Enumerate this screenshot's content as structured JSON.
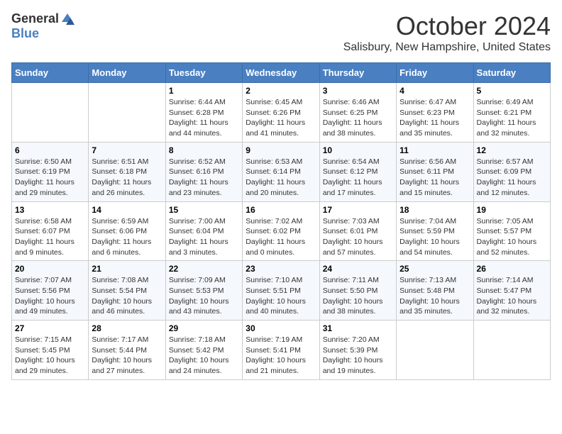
{
  "header": {
    "logo_general": "General",
    "logo_blue": "Blue",
    "month_title": "October 2024",
    "location": "Salisbury, New Hampshire, United States"
  },
  "days_of_week": [
    "Sunday",
    "Monday",
    "Tuesday",
    "Wednesday",
    "Thursday",
    "Friday",
    "Saturday"
  ],
  "weeks": [
    [
      {
        "day": "",
        "content": ""
      },
      {
        "day": "",
        "content": ""
      },
      {
        "day": "1",
        "content": "Sunrise: 6:44 AM\nSunset: 6:28 PM\nDaylight: 11 hours and 44 minutes."
      },
      {
        "day": "2",
        "content": "Sunrise: 6:45 AM\nSunset: 6:26 PM\nDaylight: 11 hours and 41 minutes."
      },
      {
        "day": "3",
        "content": "Sunrise: 6:46 AM\nSunset: 6:25 PM\nDaylight: 11 hours and 38 minutes."
      },
      {
        "day": "4",
        "content": "Sunrise: 6:47 AM\nSunset: 6:23 PM\nDaylight: 11 hours and 35 minutes."
      },
      {
        "day": "5",
        "content": "Sunrise: 6:49 AM\nSunset: 6:21 PM\nDaylight: 11 hours and 32 minutes."
      }
    ],
    [
      {
        "day": "6",
        "content": "Sunrise: 6:50 AM\nSunset: 6:19 PM\nDaylight: 11 hours and 29 minutes."
      },
      {
        "day": "7",
        "content": "Sunrise: 6:51 AM\nSunset: 6:18 PM\nDaylight: 11 hours and 26 minutes."
      },
      {
        "day": "8",
        "content": "Sunrise: 6:52 AM\nSunset: 6:16 PM\nDaylight: 11 hours and 23 minutes."
      },
      {
        "day": "9",
        "content": "Sunrise: 6:53 AM\nSunset: 6:14 PM\nDaylight: 11 hours and 20 minutes."
      },
      {
        "day": "10",
        "content": "Sunrise: 6:54 AM\nSunset: 6:12 PM\nDaylight: 11 hours and 17 minutes."
      },
      {
        "day": "11",
        "content": "Sunrise: 6:56 AM\nSunset: 6:11 PM\nDaylight: 11 hours and 15 minutes."
      },
      {
        "day": "12",
        "content": "Sunrise: 6:57 AM\nSunset: 6:09 PM\nDaylight: 11 hours and 12 minutes."
      }
    ],
    [
      {
        "day": "13",
        "content": "Sunrise: 6:58 AM\nSunset: 6:07 PM\nDaylight: 11 hours and 9 minutes."
      },
      {
        "day": "14",
        "content": "Sunrise: 6:59 AM\nSunset: 6:06 PM\nDaylight: 11 hours and 6 minutes."
      },
      {
        "day": "15",
        "content": "Sunrise: 7:00 AM\nSunset: 6:04 PM\nDaylight: 11 hours and 3 minutes."
      },
      {
        "day": "16",
        "content": "Sunrise: 7:02 AM\nSunset: 6:02 PM\nDaylight: 11 hours and 0 minutes."
      },
      {
        "day": "17",
        "content": "Sunrise: 7:03 AM\nSunset: 6:01 PM\nDaylight: 10 hours and 57 minutes."
      },
      {
        "day": "18",
        "content": "Sunrise: 7:04 AM\nSunset: 5:59 PM\nDaylight: 10 hours and 54 minutes."
      },
      {
        "day": "19",
        "content": "Sunrise: 7:05 AM\nSunset: 5:57 PM\nDaylight: 10 hours and 52 minutes."
      }
    ],
    [
      {
        "day": "20",
        "content": "Sunrise: 7:07 AM\nSunset: 5:56 PM\nDaylight: 10 hours and 49 minutes."
      },
      {
        "day": "21",
        "content": "Sunrise: 7:08 AM\nSunset: 5:54 PM\nDaylight: 10 hours and 46 minutes."
      },
      {
        "day": "22",
        "content": "Sunrise: 7:09 AM\nSunset: 5:53 PM\nDaylight: 10 hours and 43 minutes."
      },
      {
        "day": "23",
        "content": "Sunrise: 7:10 AM\nSunset: 5:51 PM\nDaylight: 10 hours and 40 minutes."
      },
      {
        "day": "24",
        "content": "Sunrise: 7:11 AM\nSunset: 5:50 PM\nDaylight: 10 hours and 38 minutes."
      },
      {
        "day": "25",
        "content": "Sunrise: 7:13 AM\nSunset: 5:48 PM\nDaylight: 10 hours and 35 minutes."
      },
      {
        "day": "26",
        "content": "Sunrise: 7:14 AM\nSunset: 5:47 PM\nDaylight: 10 hours and 32 minutes."
      }
    ],
    [
      {
        "day": "27",
        "content": "Sunrise: 7:15 AM\nSunset: 5:45 PM\nDaylight: 10 hours and 29 minutes."
      },
      {
        "day": "28",
        "content": "Sunrise: 7:17 AM\nSunset: 5:44 PM\nDaylight: 10 hours and 27 minutes."
      },
      {
        "day": "29",
        "content": "Sunrise: 7:18 AM\nSunset: 5:42 PM\nDaylight: 10 hours and 24 minutes."
      },
      {
        "day": "30",
        "content": "Sunrise: 7:19 AM\nSunset: 5:41 PM\nDaylight: 10 hours and 21 minutes."
      },
      {
        "day": "31",
        "content": "Sunrise: 7:20 AM\nSunset: 5:39 PM\nDaylight: 10 hours and 19 minutes."
      },
      {
        "day": "",
        "content": ""
      },
      {
        "day": "",
        "content": ""
      }
    ]
  ]
}
